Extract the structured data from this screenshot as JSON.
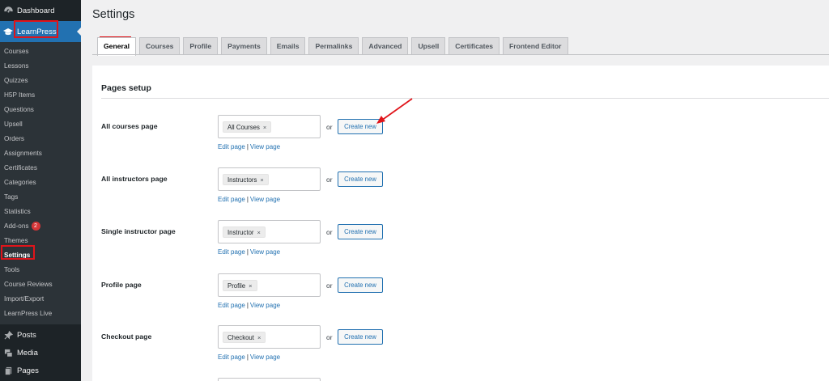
{
  "sidebar": {
    "dashboard": {
      "label": "Dashboard",
      "icon": "dashboard-icon"
    },
    "learnpress": {
      "label": "LearnPress",
      "icon": "graduation-cap-icon"
    },
    "submenu": [
      {
        "label": "Courses"
      },
      {
        "label": "Lessons"
      },
      {
        "label": "Quizzes"
      },
      {
        "label": "H5P Items"
      },
      {
        "label": "Questions"
      },
      {
        "label": "Upsell"
      },
      {
        "label": "Orders"
      },
      {
        "label": "Assignments"
      },
      {
        "label": "Certificates"
      },
      {
        "label": "Categories"
      },
      {
        "label": "Tags"
      },
      {
        "label": "Statistics"
      },
      {
        "label": "Add-ons",
        "badge": "2"
      },
      {
        "label": "Themes"
      },
      {
        "label": "Settings"
      },
      {
        "label": "Tools"
      },
      {
        "label": "Course Reviews"
      },
      {
        "label": "Import/Export"
      },
      {
        "label": "LearnPress Live"
      }
    ],
    "posts": {
      "label": "Posts",
      "icon": "pin-icon"
    },
    "media": {
      "label": "Media",
      "icon": "media-icon"
    },
    "pages": {
      "label": "Pages",
      "icon": "pages-icon"
    }
  },
  "page": {
    "title": "Settings",
    "tabs": [
      "General",
      "Courses",
      "Profile",
      "Payments",
      "Emails",
      "Permalinks",
      "Advanced",
      "Upsell",
      "Certificates",
      "Frontend Editor"
    ],
    "active_tab": "General",
    "section_title": "Pages setup",
    "or_text": "or",
    "create_label": "Create new",
    "edit_link": "Edit page",
    "link_sep": "|",
    "view_link": "View page",
    "remove_glyph": "×",
    "rows": [
      {
        "label": "All courses page",
        "value": "All Courses"
      },
      {
        "label": "All instructors page",
        "value": "Instructors"
      },
      {
        "label": "Single instructor page",
        "value": "Instructor"
      },
      {
        "label": "Profile page",
        "value": "Profile"
      },
      {
        "label": "Checkout page",
        "value": "Checkout"
      }
    ]
  },
  "colors": {
    "sidebar_bg": "#1d2327",
    "submenu_bg": "#2c3338",
    "accent": "#2271b1",
    "highlight": "#e0141a",
    "page_bg": "#f0f0f1"
  }
}
